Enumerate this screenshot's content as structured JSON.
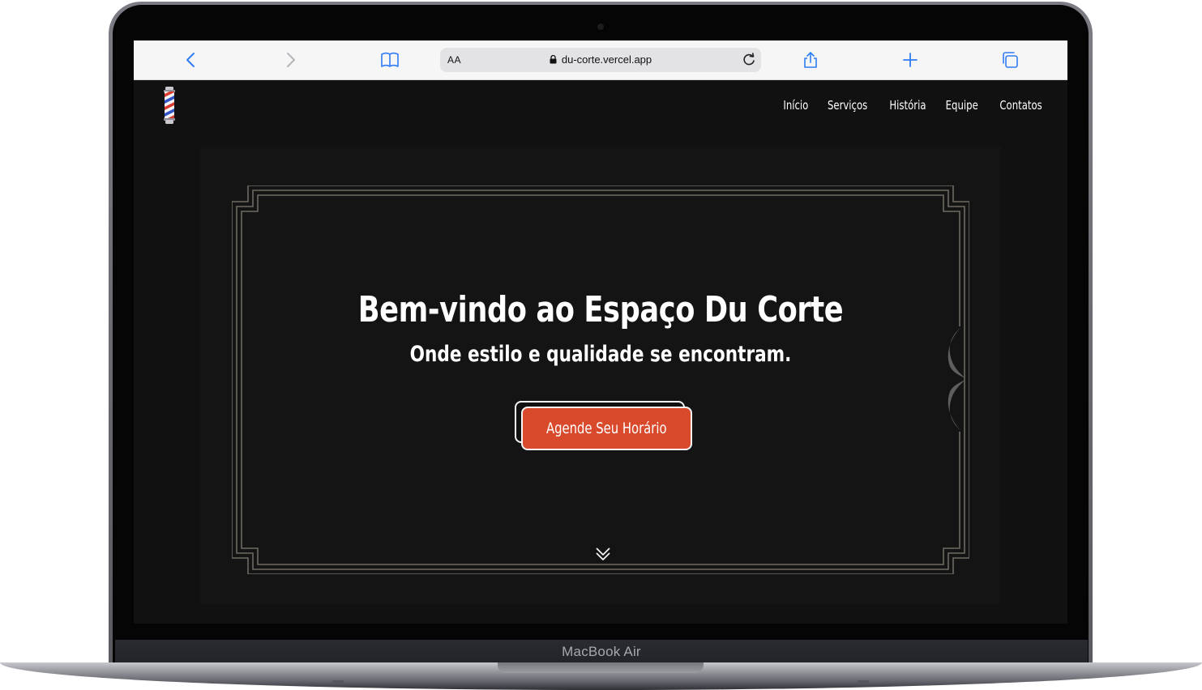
{
  "device": {
    "label": "MacBook Air"
  },
  "browser": {
    "text_size_label": "AA",
    "url": "du-corte.vercel.app",
    "icons": [
      "back-icon",
      "forward-icon",
      "bookmarks-icon",
      "lock-icon",
      "reload-icon",
      "share-icon",
      "new-tab-icon",
      "tabs-icon"
    ]
  },
  "site": {
    "nav": [
      "Início",
      "Serviços",
      "História",
      "Equipe",
      "Contatos"
    ],
    "hero": {
      "title": "Bem-vindo ao Espaço Du Corte",
      "subtitle": "Onde estilo e qualidade se encontram.",
      "cta": "Agende Seu Horário"
    }
  },
  "colors": {
    "page_background": "#111111",
    "accent": "#d94a2c",
    "frame_line": "#6e6a62",
    "browser_blue": "#2f7cf6"
  }
}
